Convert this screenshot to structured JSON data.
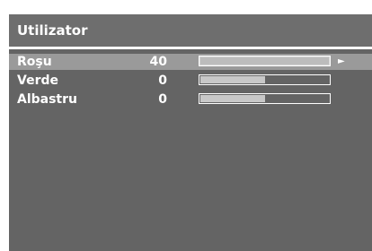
{
  "menu": {
    "title": "Utilizator",
    "items": [
      {
        "label": "Roşu",
        "value": "40",
        "level": 1.0,
        "selected": true,
        "arrow": "►"
      },
      {
        "label": "Verde",
        "value": "0",
        "level": 0.5,
        "selected": false
      },
      {
        "label": "Albastru",
        "value": "0",
        "level": 0.5,
        "selected": false
      }
    ]
  },
  "colors": {
    "panel": "#646464",
    "header": "#6e6e6e",
    "selected_row": "#9a9a9a",
    "text": "#ffffff"
  }
}
